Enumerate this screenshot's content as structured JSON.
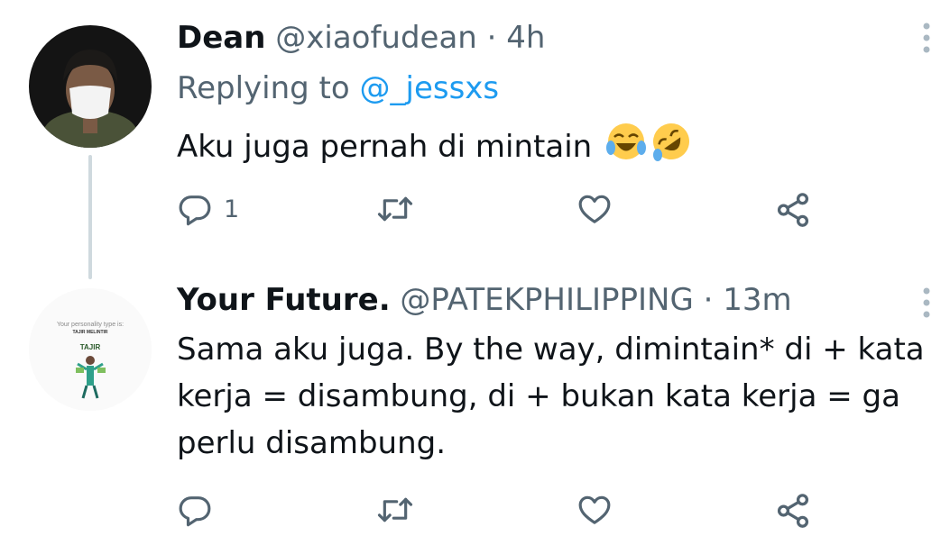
{
  "tweets": [
    {
      "name": "Dean",
      "handle": "@xiaofudean",
      "separator": "·",
      "time": "4h",
      "replying_label": "Replying to",
      "replying_handle": "@_jessxs",
      "text": "Aku juga pernah di mintain",
      "emojis": [
        "face-with-tears-of-joy",
        "rolling-on-the-floor-laughing"
      ],
      "reply_count": "1"
    },
    {
      "name": "Your Future.",
      "handle": "@PATEKPHILIPPING",
      "separator": "·",
      "time": "13m",
      "text_lines": [
        "Sama aku juga. By the way, dimintain* di + kata",
        "kerja = disambung, di + bukan kata kerja = ga",
        "perlu disambung."
      ],
      "avatar": {
        "caption": "Your personality type is:",
        "subcaption": "TAJIR MELINTIR",
        "label": "TAJIR"
      },
      "reply_count": ""
    }
  ],
  "icons": [
    "reply-icon",
    "retweet-icon",
    "like-icon",
    "share-icon",
    "more-options-icon"
  ],
  "colors": {
    "link": "#1d9bf0",
    "secondary": "#536471",
    "text": "#0f1419",
    "thread_line": "#cfd9de"
  }
}
